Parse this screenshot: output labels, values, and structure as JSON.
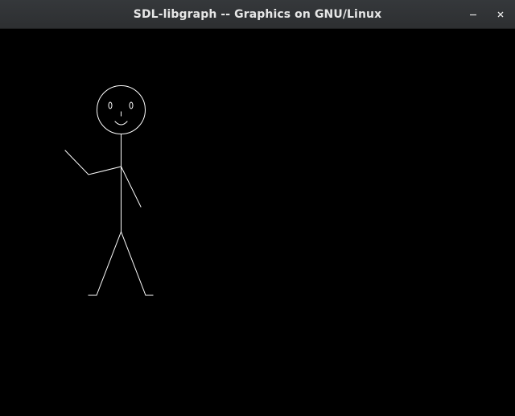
{
  "window": {
    "title": "SDL-libgraph -- Graphics on GNU/Linux"
  },
  "titlebar": {
    "minimize_icon": "minimize-icon",
    "close_icon": "close-icon"
  },
  "canvas": {
    "background": "#000000",
    "stroke_color": "#ffffff",
    "drawing": "stick-figure"
  }
}
